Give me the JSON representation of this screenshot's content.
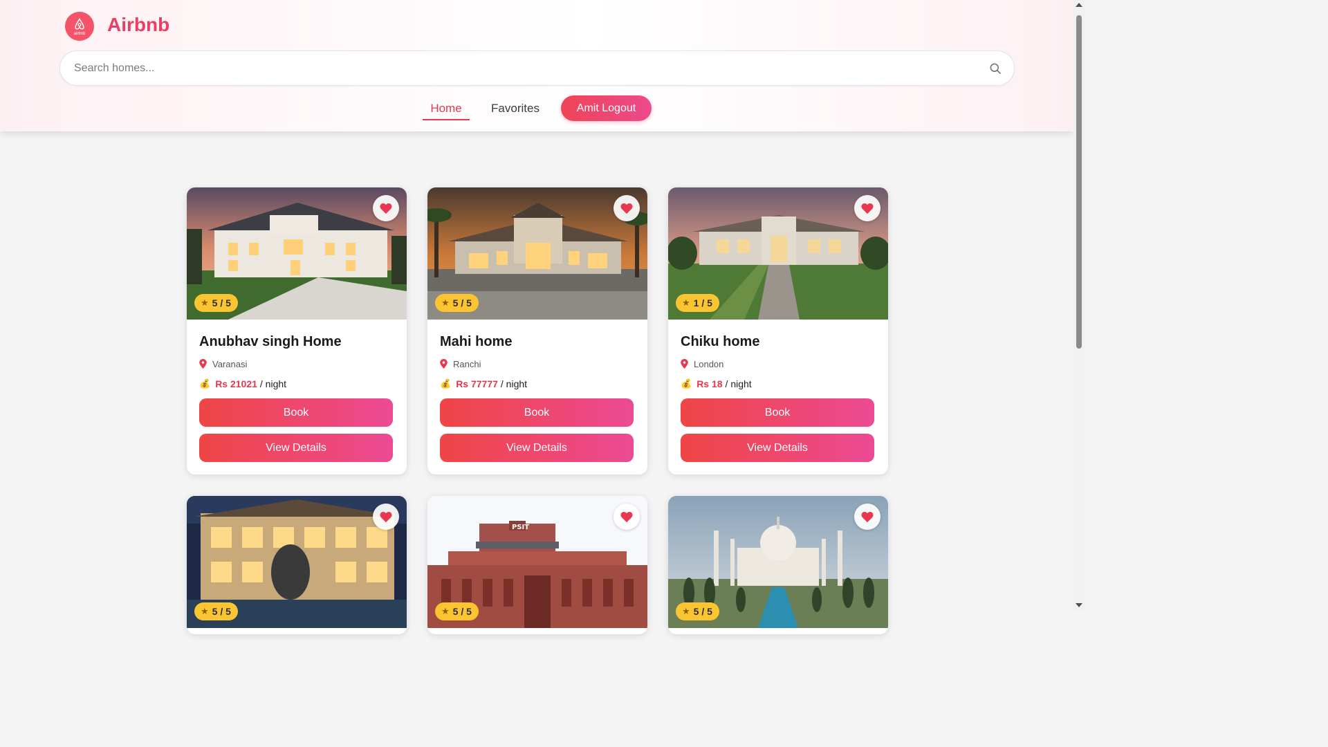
{
  "app": {
    "brand": "Airbnb",
    "logo_text": "airbnb"
  },
  "search": {
    "placeholder": "Search homes..."
  },
  "nav": {
    "home": "Home",
    "favorites": "Favorites",
    "logout": "Amit  Logout"
  },
  "card_labels": {
    "book": "Book",
    "view_details": "View Details",
    "per_night": "/ night"
  },
  "homes": [
    {
      "name": "Anubhav singh Home",
      "location": "Varanasi",
      "price": "Rs 21021",
      "rating": "5 / 5"
    },
    {
      "name": "Mahi home",
      "location": "Ranchi",
      "price": "Rs 77777",
      "rating": "5 / 5"
    },
    {
      "name": "Chiku home",
      "location": "London",
      "price": "Rs 18",
      "rating": "1 / 5"
    },
    {
      "rating": "5 / 5"
    },
    {
      "rating": "5 / 5"
    },
    {
      "rating": "5 / 5"
    }
  ],
  "colors": {
    "accent": "#e5384f",
    "brand": "#ea3e64",
    "badge": "#fbc531"
  },
  "icons": {
    "favorite": "heart-icon",
    "rating": "star-icon",
    "location": "pin-icon",
    "price": "money-bag-icon",
    "search": "search-icon"
  }
}
